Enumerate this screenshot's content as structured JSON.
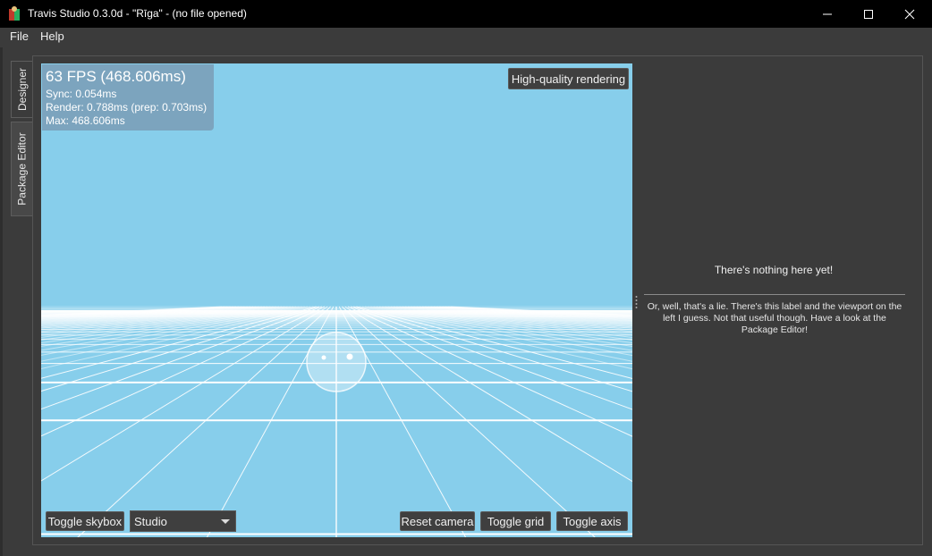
{
  "window": {
    "title": "Travis Studio 0.3.0d - \"Rīga\" - (no file opened)",
    "controls": [
      "minimize-icon",
      "maximize-icon",
      "close-icon"
    ]
  },
  "menu": {
    "file": "File",
    "help": "Help"
  },
  "side_tabs": {
    "designer": "Designer",
    "package_editor": "Package Editor"
  },
  "viewport": {
    "sky_color": "#87ceeb",
    "grid_color": "#ffffff",
    "stats": {
      "fps": "63 FPS (468.606ms)",
      "sync": "Sync: 0.054ms",
      "render": "Render: 0.788ms (prep: 0.703ms)",
      "max": "Max: 468.606ms"
    },
    "high_quality_button": "High-quality rendering",
    "toggle_skybox_button": "Toggle skybox",
    "skybox_select": "Studio",
    "reset_camera_button": "Reset camera",
    "toggle_grid_button": "Toggle grid",
    "toggle_axis_button": "Toggle axis"
  },
  "right_panel": {
    "title": "There's nothing here yet!",
    "description": "Or, well, that's a lie. There's this label and the viewport on the left I guess. Not that useful though. Have a look at the Package Editor!"
  }
}
